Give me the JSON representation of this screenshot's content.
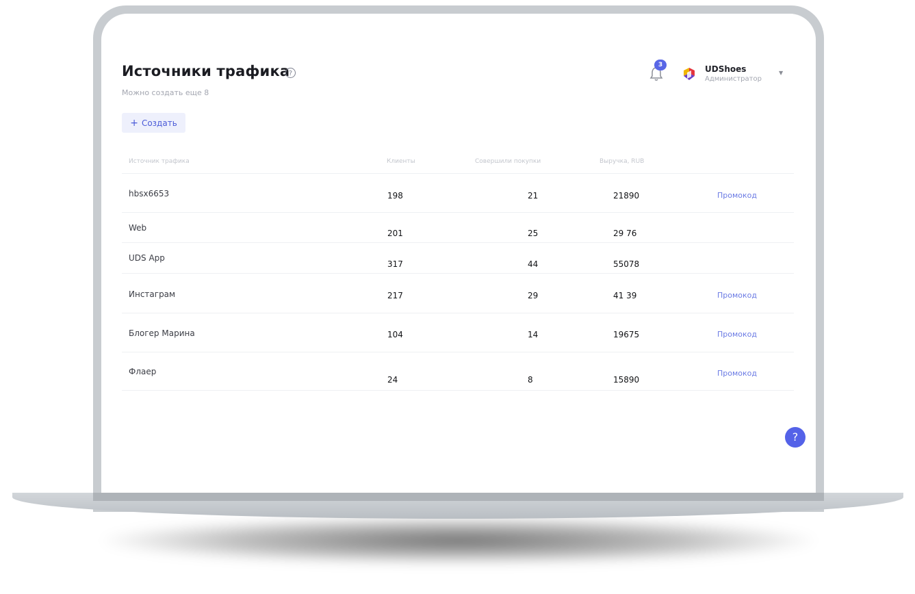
{
  "page": {
    "title": "Источники трафика",
    "help_icon": "question-circle-icon",
    "subtitle": "Можно создать еще 8",
    "create_label": "Создать",
    "create_icon": "plus-icon"
  },
  "header": {
    "notifications_count": "3",
    "bell_icon": "bell-icon",
    "user_name": "UDShoes",
    "user_role": "Администратор",
    "caret_icon": "caret-down-icon"
  },
  "table": {
    "columns": [
      "Источник трафика",
      "Клиенты",
      "Совершили покупки",
      "Выручка, RUB"
    ],
    "rows": [
      {
        "source": "hbsx6653",
        "clients": "198",
        "purchases": "21",
        "revenue": "21890",
        "action": "Промокод"
      },
      {
        "source": "Web",
        "clients": "201",
        "purchases": "25",
        "revenue": "29 76",
        "action": ""
      },
      {
        "source": "UDS App",
        "clients": "317",
        "purchases": "44",
        "revenue": "55078",
        "action": ""
      },
      {
        "source": "Инстаграм",
        "clients": "217",
        "purchases": "29",
        "revenue": "41 39",
        "action": "Промокод"
      },
      {
        "source": "Блогер Марина",
        "clients": "104",
        "purchases": "14",
        "revenue": "19675",
        "action": "Промокод"
      },
      {
        "source": "Флаер",
        "clients": "24",
        "purchases": "8",
        "revenue": "15890",
        "action": "Промокод"
      }
    ]
  },
  "support": {
    "label": "?"
  },
  "colors": {
    "accent": "#5462e8",
    "link": "#6a7ae4",
    "button_bg": "#eef0fc"
  }
}
